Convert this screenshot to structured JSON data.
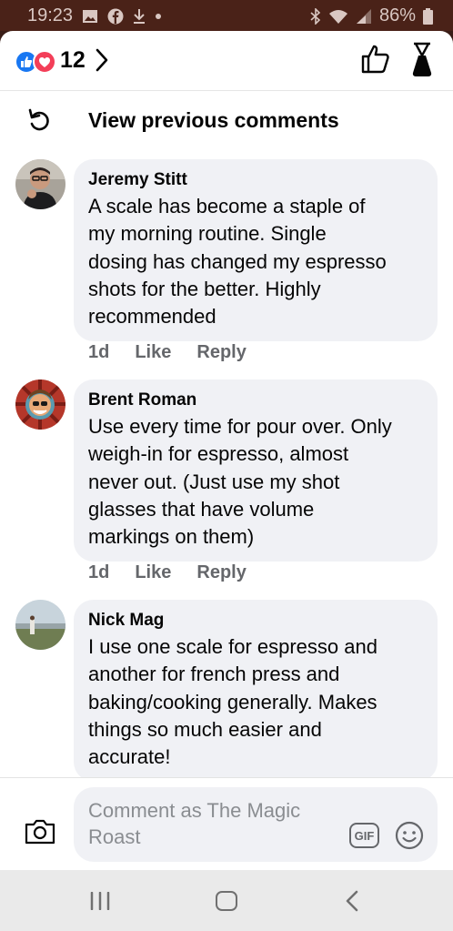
{
  "status_bar": {
    "time": "19:23",
    "battery": "86%",
    "icons": [
      "gallery-icon",
      "facebook-icon",
      "download-icon",
      "dot-icon",
      "bluetooth-icon",
      "wifi-icon",
      "signal-icon",
      "battery-icon"
    ]
  },
  "header": {
    "reaction_count": "12",
    "reaction_icons": [
      "like-reaction-icon",
      "love-reaction-icon"
    ],
    "actions": [
      "thumbs-up-icon",
      "coffee-dripper-icon"
    ]
  },
  "view_previous": {
    "label": "View previous comments"
  },
  "comments": [
    {
      "author": "Jeremy Stitt",
      "lines": [
        "A scale has become a staple of",
        "my morning routine.  Single",
        "dosing has changed my espresso",
        "shots for the better.  Highly",
        "recommended"
      ],
      "time": "1d",
      "like": "Like",
      "reply": "Reply"
    },
    {
      "author": "Brent Roman",
      "lines": [
        "Use every time for pour over. Only",
        "weigh-in for espresso, almost",
        "never out. (Just use my shot",
        "glasses that have volume",
        "markings on them)"
      ],
      "time": "1d",
      "like": "Like",
      "reply": "Reply"
    },
    {
      "author": "Nick Mag",
      "lines": [
        "I use one scale for espresso and",
        "another for french press and",
        "baking/cooking generally. Makes",
        "things so much easier and",
        "accurate!"
      ]
    }
  ],
  "composer": {
    "placeholder": "Comment as The Magic Roast",
    "gif_label": "GIF"
  },
  "colors": {
    "facebook_blue": "#1877f2",
    "love_red": "#f33e58",
    "bubble_bg": "#f0f1f5",
    "meta_gray": "#65676b",
    "status_bar_bg": "#4a2218"
  }
}
